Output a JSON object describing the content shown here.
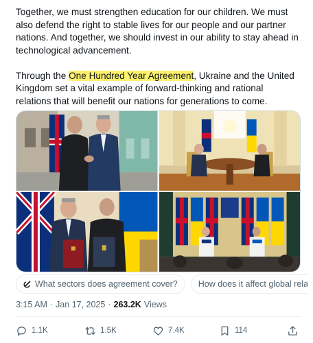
{
  "post": {
    "paragraph1": "Together, we must strengthen education for our children. We must also defend the right to stable lives for our people and our partner nations. And together, we should invest in our ability to stay ahead in technological advancement.",
    "paragraph2_before": "Through the ",
    "paragraph2_highlight": "One Hundred Year Agreement",
    "paragraph2_after": ", Ukraine and the United Kingdom set a vital example of forward-thinking and rational relations that will benefit our nations for generations to come."
  },
  "media": {
    "images": [
      {
        "icon": "handshake-photo"
      },
      {
        "icon": "meeting-photo"
      },
      {
        "icon": "signed-folders-photo"
      },
      {
        "icon": "press-conference-photo"
      }
    ]
  },
  "suggestions": [
    {
      "label": "What sectors does agreement cover?"
    },
    {
      "label": "How does it affect global relations?"
    }
  ],
  "meta": {
    "time": "3:15 AM",
    "separator": "·",
    "date": "Jan 17, 2025",
    "views_count": "263.2K",
    "views_label": "Views"
  },
  "actions": {
    "replies": "1.1K",
    "reposts": "1.5K",
    "likes": "7.4K",
    "bookmarks": "114"
  },
  "colors": {
    "text": "#0f1419",
    "secondary": "#536471",
    "highlight": "#fff16b",
    "border": "#cfd9de"
  }
}
